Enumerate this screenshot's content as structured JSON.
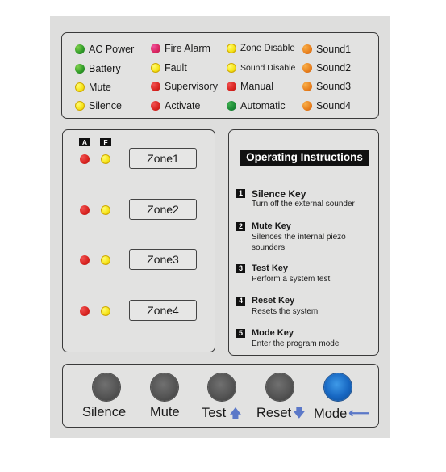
{
  "status_indicators": [
    {
      "label": "AC  Power",
      "color": "green"
    },
    {
      "label": "Battery",
      "color": "green"
    },
    {
      "label": "Mute",
      "color": "yellow"
    },
    {
      "label": "Silence",
      "color": "yellow"
    },
    {
      "label": "Fire  Alarm",
      "color": "magenta"
    },
    {
      "label": "Fault",
      "color": "yellow"
    },
    {
      "label": "Supervisory",
      "color": "red"
    },
    {
      "label": "Activate",
      "color": "red"
    },
    {
      "label": "Zone  Disable",
      "color": "yellow"
    },
    {
      "label": "Sound  Disable",
      "color": "yellow"
    },
    {
      "label": "Manual",
      "color": "red"
    },
    {
      "label": "Automatic",
      "color": "dgreen"
    },
    {
      "label": "Sound1",
      "color": "orange"
    },
    {
      "label": "Sound2",
      "color": "orange"
    },
    {
      "label": "Sound3",
      "color": "orange"
    },
    {
      "label": "Sound4",
      "color": "orange"
    }
  ],
  "zones": {
    "alarm_tag": "A",
    "fault_tag": "F",
    "items": [
      {
        "label": "Zone1"
      },
      {
        "label": "Zone2"
      },
      {
        "label": "Zone3"
      },
      {
        "label": "Zone4"
      }
    ]
  },
  "instructions": {
    "title": "Operating Instructions",
    "items": [
      {
        "num": "1",
        "key": "Silence Key",
        "desc": "Turn off the external sounder"
      },
      {
        "num": "2",
        "key": "Mute Key",
        "desc": "Silences the internal piezo sounders"
      },
      {
        "num": "3",
        "key": "Test Key",
        "desc": "Perform a system test"
      },
      {
        "num": "4",
        "key": "Reset Key",
        "desc": "Resets the system"
      },
      {
        "num": "5",
        "key": "Mode Key",
        "desc": "Enter the program mode"
      }
    ]
  },
  "keys": [
    {
      "label": "Silence",
      "arrow": ""
    },
    {
      "label": "Mute",
      "arrow": ""
    },
    {
      "label": "Test",
      "arrow": "🡅"
    },
    {
      "label": "Reset",
      "arrow": "🡇"
    },
    {
      "label": "Mode",
      "arrow": "⟵"
    }
  ],
  "colors": {
    "panel": "#dededd",
    "mode_key": "#1767c2",
    "arrow": "#5b78c8"
  }
}
